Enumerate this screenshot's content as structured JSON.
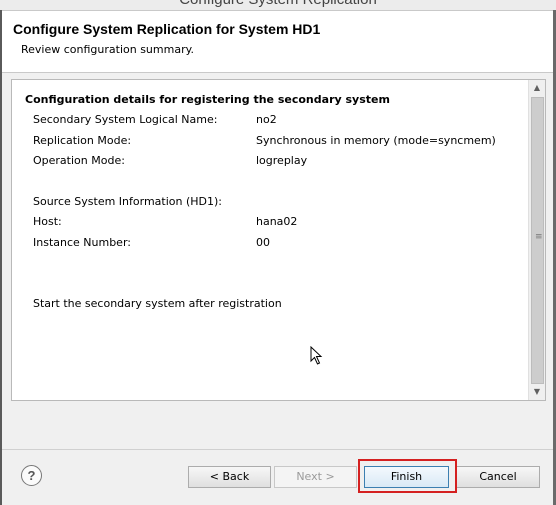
{
  "window": {
    "title": "Configure System Replication"
  },
  "header": {
    "title": "Configure System Replication for System HD1",
    "description": "Review configuration summary."
  },
  "summary": {
    "heading": "Configuration details for registering the secondary system",
    "fields": [
      {
        "label": "Secondary System Logical Name:",
        "value": "no2"
      },
      {
        "label": "Replication Mode:",
        "value": "Synchronous in memory (mode=syncmem)"
      },
      {
        "label": "Operation Mode:",
        "value": "logreplay"
      }
    ],
    "source_heading": "Source System Information (HD1):",
    "source_fields": [
      {
        "label": "Host:",
        "value": "hana02"
      },
      {
        "label": "Instance Number:",
        "value": "00"
      }
    ],
    "action_note": "Start the secondary system after registration"
  },
  "footer": {
    "help": "?",
    "back_label": "< Back",
    "next_label": "Next >",
    "finish_label": "Finish",
    "cancel_label": "Cancel"
  },
  "colors": {
    "highlight": "#d42020",
    "finish_border": "#3c7fb1"
  },
  "icons": {
    "help": "help-question-icon",
    "scroll_up": "scroll-up-arrow-icon",
    "scroll_down": "scroll-down-arrow-icon",
    "cursor": "mouse-pointer-icon"
  }
}
